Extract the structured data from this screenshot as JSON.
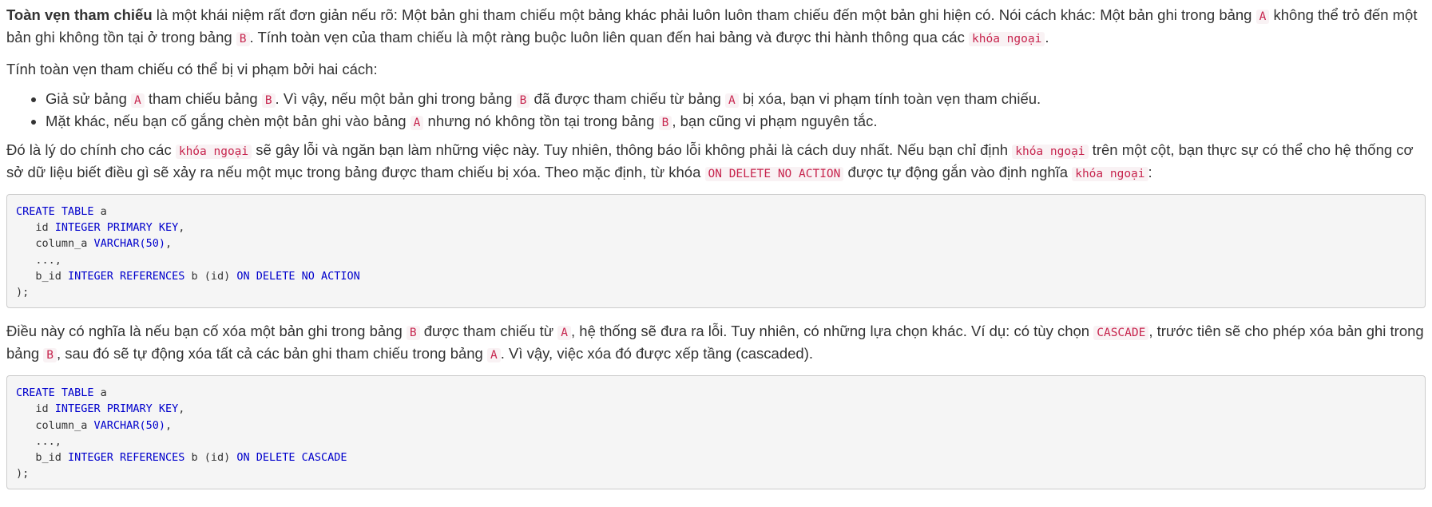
{
  "p1": {
    "term": "Toàn vẹn tham chiếu",
    "t1": " là một khái niệm rất đơn giản nếu rõ: Một bản ghi tham chiếu một bảng khác phải luôn luôn tham chiếu đến một bản ghi hiện có. Nói cách khác: Một bản ghi trong bảng ",
    "c1": "A",
    "t2": " không thể trỏ đến một bản ghi không tồn tại ở trong bảng ",
    "c2": "B",
    "t3": ".  Tính toàn vẹn của tham chiếu là một ràng buộc luôn liên quan đến hai bảng và được thi hành thông qua các ",
    "c3": "khóa ngoại",
    "t4": "."
  },
  "p2": "Tính toàn vẹn tham chiếu có thể bị vi phạm bởi hai cách:",
  "list": {
    "li1": {
      "t1": "Giả sử bảng ",
      "c1": "A",
      "t2": " tham chiếu bảng ",
      "c2": "B",
      "t3": ". Vì vậy, nếu một bản ghi trong bảng ",
      "c3": "B",
      "t4": " đã được tham chiếu từ bảng ",
      "c4": "A",
      "t5": " bị xóa, bạn vi phạm tính toàn vẹn tham chiếu."
    },
    "li2": {
      "t1": "Mặt khác, nếu bạn cố gắng chèn một bản ghi vào bảng ",
      "c1": "A",
      "t2": " nhưng nó không tồn tại trong bảng ",
      "c2": "B",
      "t3": ", bạn cũng vi phạm nguyên tắc."
    }
  },
  "p3": {
    "t1": "Đó là lý do chính cho các ",
    "c1": "khóa ngoại",
    "t2": " sẽ gây lỗi và ngăn bạn làm những việc này. Tuy nhiên, thông báo lỗi không phải là cách duy nhất. Nếu bạn chỉ định ",
    "c2": "khóa ngoại",
    "t3": " trên một cột, bạn thực sự có thể cho hệ thống cơ sở dữ liệu biết điều gì sẽ xảy ra nếu một mục trong bảng được tham chiếu bị xóa. Theo mặc định, từ khóa ",
    "c3": "ON DELETE NO ACTION",
    "t4": " được tự động gắn vào định nghĩa ",
    "c4": "khóa ngoại",
    "t5": ":"
  },
  "code1": {
    "l1_kw": "CREATE TABLE",
    "l1_t": " a",
    "l2_t": "   id ",
    "l2_kw": "INTEGER PRIMARY KEY",
    "l2_t2": ",",
    "l3_t": "   column_a ",
    "l3_kw": "VARCHAR(50)",
    "l3_t2": ",",
    "l4_t": "   ...,",
    "l5_t": "   b_id ",
    "l5_kw": "INTEGER REFERENCES",
    "l5_t2": " b (id) ",
    "l5_kw2": "ON DELETE NO ACTION",
    "l6_t": ");"
  },
  "p4": {
    "t1": "Điều này có nghĩa là nếu bạn cố xóa một bản ghi trong bảng ",
    "c1": "B",
    "t2": " được tham chiếu từ ",
    "c2": "A",
    "t3": ", hệ thống sẽ đưa ra lỗi. Tuy nhiên, có những lựa chọn khác. Ví dụ: có tùy chọn ",
    "c3": "CASCADE",
    "t4": ", trước tiên sẽ cho phép xóa bản ghi trong bảng ",
    "c4": "B",
    "t5": ", sau đó sẽ tự động xóa tất cả các bản ghi tham chiếu trong bảng ",
    "c5": "A",
    "t6": ". Vì vậy, việc xóa đó được xếp tầng (cascaded)."
  },
  "code2": {
    "l1_kw": "CREATE TABLE",
    "l1_t": " a",
    "l2_t": "   id ",
    "l2_kw": "INTEGER PRIMARY KEY",
    "l2_t2": ",",
    "l3_t": "   column_a ",
    "l3_kw": "VARCHAR(50)",
    "l3_t2": ",",
    "l4_t": "   ...,",
    "l5_t": "   b_id ",
    "l5_kw": "INTEGER REFERENCES",
    "l5_t2": " b (id) ",
    "l5_kw2": "ON DELETE CASCADE",
    "l6_t": ");"
  },
  "colors": {
    "text": "#333333",
    "inline_code": "#c7254e",
    "inline_code_bg": "#f9f2f4",
    "sql_keyword": "#0000cc",
    "code_block_bg": "#f5f5f5"
  }
}
